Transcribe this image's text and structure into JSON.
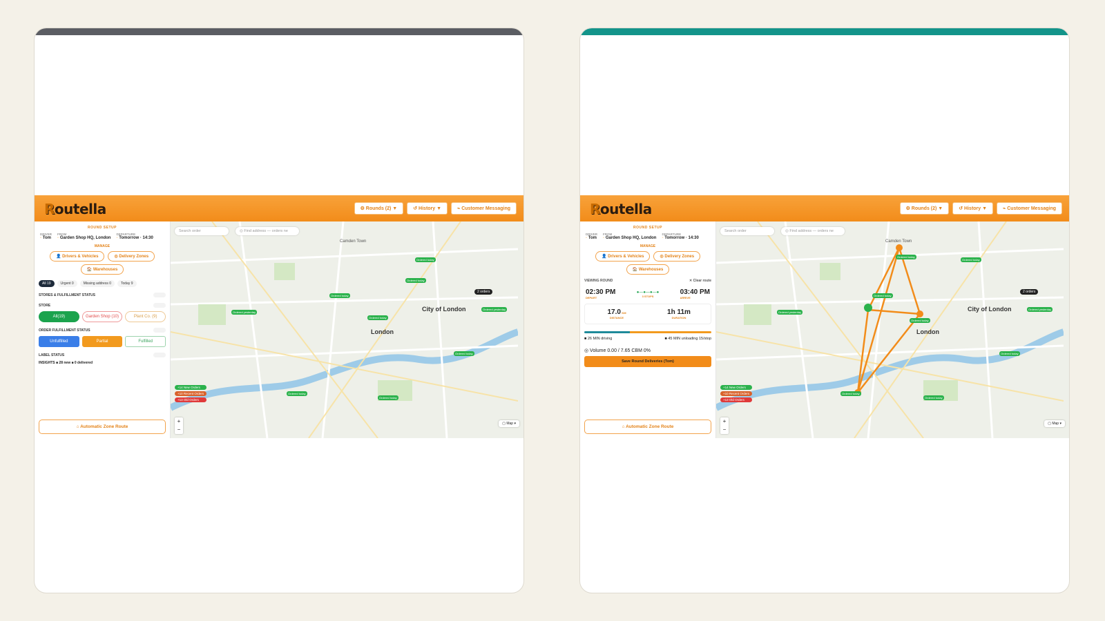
{
  "app": {
    "logo": "Routella"
  },
  "header": {
    "rounds": "⚙ Rounds (2) ▼",
    "history": "↺ History ▼",
    "messaging": "⌁ Customer Messaging"
  },
  "panel": {
    "round_setup": "ROUND SETUP",
    "driver_k": "DRIVER",
    "driver_v": "Tom",
    "from_k": "FROM",
    "from_v": "Garden Shop HQ, London",
    "departure_k": "DEPARTURE",
    "departure_v": "Tomorrow · 14:30",
    "manage": "MANAGE",
    "drivers_vehicles": "👤 Drivers & Vehicles",
    "delivery_zones": "◎ Delivery Zones",
    "warehouses": "🏠 Warehouses",
    "filter_all": "All 19",
    "filter_urgent": "Urgent 0",
    "filter_missing": "Missing address 0",
    "filter_today": "Today 9",
    "stores_status": "STORES & FULFILLMENT STATUS",
    "store": "STORE",
    "store_all": "All(19)",
    "store_garden": "Garden Shop (10)",
    "store_plant": "Plant Co. (9)",
    "order_status": "ORDER FULFILLMENT STATUS",
    "unfulfilled": "Unfulfilled",
    "partial": "Partial",
    "fulfilled": "Fulfilled",
    "label_status": "LABEL STATUS",
    "insights": "INSIGHTS  ■ 28 new  ■ 0 delivered",
    "auto_zone": "⌂ Automatic Zone Route"
  },
  "route": {
    "viewing": "VIEWING ROUND",
    "clear": "✕ Clear route",
    "depart_time": "02:30 PM",
    "arrive_time": "03:40 PM",
    "depart": "DEPART",
    "arrive": "ARRIVE",
    "stops": "3 STOPS",
    "distance": "17.0",
    "distance_unit": "KM",
    "distance_lbl": "DISTANCE",
    "duration": "1h 11m",
    "duration_lbl": "DURATION",
    "driving": "■ 26 MIN driving",
    "unloading": "■ 45 MIN unloading 15/stop",
    "volume": "◎ Volume 0.00 / 7.65 CBM  0%",
    "save": "Save Round Deliveries (Tom)"
  },
  "map": {
    "search": "Search order",
    "find": "◎ Find address — orders ne",
    "camden": "Camden Town",
    "city": "City of London",
    "london": "London",
    "orders2": "2 orders",
    "legend_new": "+14 New Orders",
    "legend_recent": "+10 Recent Orders",
    "legend_old": "+13 Old Orders",
    "maptype": "▢ Map ▾",
    "plus": "+",
    "minus": "−"
  }
}
